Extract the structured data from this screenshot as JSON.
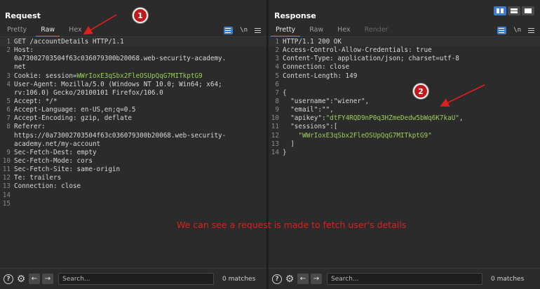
{
  "request": {
    "title": "Request",
    "tabs": [
      {
        "label": "Pretty",
        "active": false
      },
      {
        "label": "Raw",
        "active": true
      },
      {
        "label": "Hex",
        "active": false
      }
    ],
    "newline_label": "\\n",
    "lines": [
      {
        "num": "1",
        "text": "GET /accountDetails HTTP/1.1"
      },
      {
        "num": "2",
        "text": "Host:"
      },
      {
        "num": "",
        "text": "0a73002703504f63c036079300b20068.web-security-academy."
      },
      {
        "num": "",
        "text": "net"
      },
      {
        "num": "3",
        "key": "Cookie: session=",
        "value": "WWrIoxE3qSbx2FleOSUpQqG7MITkptG9"
      },
      {
        "num": "4",
        "text": "User-Agent: Mozilla/5.0 (Windows NT 10.0; Win64; x64;"
      },
      {
        "num": "",
        "text": "rv:106.0) Gecko/20100101 Firefox/106.0"
      },
      {
        "num": "5",
        "text": "Accept: */*"
      },
      {
        "num": "6",
        "text": "Accept-Language: en-US,en;q=0.5"
      },
      {
        "num": "7",
        "text": "Accept-Encoding: gzip, deflate"
      },
      {
        "num": "8",
        "text": "Referer:"
      },
      {
        "num": "",
        "text": "https://0a73002703504f63c036079300b20068.web-security-"
      },
      {
        "num": "",
        "text": "academy.net/my-account"
      },
      {
        "num": "9",
        "text": "Sec-Fetch-Dest: empty"
      },
      {
        "num": "10",
        "text": "Sec-Fetch-Mode: cors"
      },
      {
        "num": "11",
        "text": "Sec-Fetch-Site: same-origin"
      },
      {
        "num": "12",
        "text": "Te: trailers"
      },
      {
        "num": "13",
        "text": "Connection: close"
      },
      {
        "num": "14",
        "text": ""
      },
      {
        "num": "15",
        "text": ""
      }
    ],
    "search_placeholder": "Search...",
    "matches": "0 matches"
  },
  "response": {
    "title": "Response",
    "tabs": [
      {
        "label": "Pretty",
        "active": true
      },
      {
        "label": "Raw",
        "active": false
      },
      {
        "label": "Hex",
        "active": false
      },
      {
        "label": "Render",
        "active": false,
        "disabled": true
      }
    ],
    "newline_label": "\\n",
    "lines": [
      {
        "num": "1",
        "text": "HTTP/1.1 200 OK"
      },
      {
        "num": "2",
        "text": "Access-Control-Allow-Credentials: true"
      },
      {
        "num": "3",
        "text": "Content-Type: application/json; charset=utf-8"
      },
      {
        "num": "4",
        "text": "Connection: close"
      },
      {
        "num": "5",
        "text": "Content-Length: 149"
      },
      {
        "num": "6",
        "text": ""
      },
      {
        "num": "7",
        "text": "{"
      },
      {
        "num": "8",
        "text": "  \"username\":\"wiener\","
      },
      {
        "num": "9",
        "text": "  \"email\":\"\","
      },
      {
        "num": "10",
        "key": "  \"apikey\":",
        "value": "\"dtFY4RQD9nP0q3HZmeDedw5bWq6K7kaU\"",
        "tail": ","
      },
      {
        "num": "11",
        "text": "  \"sessions\":["
      },
      {
        "num": "12",
        "key": "    ",
        "value": "\"WWrIoxE3qSbx2FleOSUpQqG7MITkptG9\"",
        "tail": ""
      },
      {
        "num": "13",
        "text": "  ]"
      },
      {
        "num": "14",
        "text": "}"
      }
    ],
    "search_placeholder": "Search...",
    "matches": "0 matches"
  },
  "annotations": {
    "badge_1": "1",
    "badge_2": "2",
    "note": "We can see a request is made to fetch user's details",
    "color": "#e0201e"
  },
  "colors": {
    "background": "#2b2b2b",
    "accent_tab": "#e8672a",
    "tool_blue": "#3b7ed0",
    "cookie_value": "#9bd05a"
  }
}
